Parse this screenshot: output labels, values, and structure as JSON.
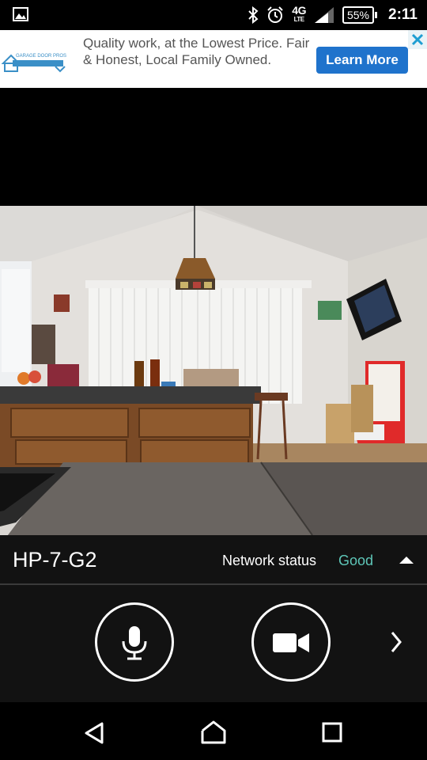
{
  "status_bar": {
    "network": "4G",
    "network_sub": "LTE",
    "battery": "55%",
    "time": "2:11"
  },
  "ad": {
    "text": "Quality work, at the Lowest Price. Fair & Honest, Local Family Owned.",
    "cta": "Learn More",
    "logo_text": "GARAGE DOOR PROS"
  },
  "camera_info": {
    "name": "HP-7-G2",
    "network_label": "Network status",
    "network_value": "Good"
  },
  "controls": [
    "microphone-icon",
    "video-camera-icon",
    "chevron-right-icon"
  ],
  "nav": [
    "back",
    "home",
    "recents"
  ]
}
